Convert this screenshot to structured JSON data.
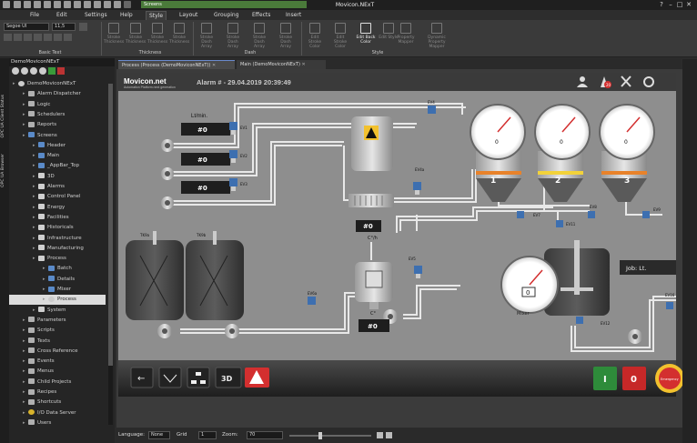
{
  "app": {
    "title": "Movicon.NExT",
    "screens_tab": "Screens"
  },
  "menu": [
    "File",
    "Edit",
    "Settings",
    "Help",
    "Style",
    "Layout",
    "Grouping",
    "Effects",
    "Insert"
  ],
  "ribbon": {
    "font_name": "Segoe UI",
    "font_size": "11,5",
    "groups": [
      "Basic Text",
      "Thickness",
      "Dash",
      "Style"
    ],
    "buttons": [
      {
        "label": "Stroke Thickness",
        "active": false
      },
      {
        "label": "Stroke Thickness",
        "active": false
      },
      {
        "label": "Stroke Thickness",
        "active": false
      },
      {
        "label": "Stroke Thickness",
        "active": false
      },
      {
        "label": "Stroke Dash Array",
        "active": false
      },
      {
        "label": "Stroke Dash Array",
        "active": false
      },
      {
        "label": "Stroke Dash Array",
        "active": false
      },
      {
        "label": "Stroke Dash Array",
        "active": false
      },
      {
        "label": "Edit Stroke Color",
        "active": false
      },
      {
        "label": "Edit Stroke Color",
        "active": false
      },
      {
        "label": "Edit Back Color",
        "active": true
      },
      {
        "label": "Edit Style",
        "active": false
      },
      {
        "label": "Property Mapper",
        "active": false
      },
      {
        "label": "Dynamic Property Mapper",
        "active": false
      }
    ]
  },
  "project_explorer": {
    "title": "DemoMoviconNExT",
    "side_tabs": [
      "OPC UA Client Status",
      "OPC UA Browser"
    ],
    "tree": [
      {
        "label": "DemoMoviconNExT",
        "level": 0,
        "icon": "gear",
        "selected": false
      },
      {
        "label": "Alarm Dispatcher",
        "level": 1,
        "icon": "item",
        "selected": false
      },
      {
        "label": "Logic",
        "level": 1,
        "icon": "item",
        "selected": false
      },
      {
        "label": "Schedulers",
        "level": 1,
        "icon": "item",
        "selected": false
      },
      {
        "label": "Reports",
        "level": 1,
        "icon": "item",
        "selected": false
      },
      {
        "label": "Screens",
        "level": 1,
        "icon": "screen",
        "selected": false
      },
      {
        "label": "Header",
        "level": 2,
        "icon": "screen",
        "selected": false
      },
      {
        "label": "Main",
        "level": 2,
        "icon": "screen",
        "selected": false
      },
      {
        "label": "_AppBar_Top",
        "level": 2,
        "icon": "screen",
        "selected": false
      },
      {
        "label": "3D",
        "level": 2,
        "icon": "folder",
        "selected": false
      },
      {
        "label": "Alarms",
        "level": 2,
        "icon": "folder",
        "selected": false
      },
      {
        "label": "Control Panel",
        "level": 2,
        "icon": "folder",
        "selected": false
      },
      {
        "label": "Energy",
        "level": 2,
        "icon": "folder",
        "selected": false
      },
      {
        "label": "Facilities",
        "level": 2,
        "icon": "folder",
        "selected": false
      },
      {
        "label": "Historicals",
        "level": 2,
        "icon": "folder",
        "selected": false
      },
      {
        "label": "Infrastructure",
        "level": 2,
        "icon": "folder",
        "selected": false
      },
      {
        "label": "Manufacturing",
        "level": 2,
        "icon": "folder",
        "selected": false
      },
      {
        "label": "Process",
        "level": 2,
        "icon": "folder",
        "selected": false
      },
      {
        "label": "Batch",
        "level": 3,
        "icon": "screen",
        "selected": false
      },
      {
        "label": "Details",
        "level": 3,
        "icon": "screen",
        "selected": false
      },
      {
        "label": "Mixer",
        "level": 3,
        "icon": "screen",
        "selected": false
      },
      {
        "label": "Process",
        "level": 3,
        "icon": "gear",
        "selected": true
      },
      {
        "label": "System",
        "level": 2,
        "icon": "folder",
        "selected": false
      },
      {
        "label": "Parameters",
        "level": 1,
        "icon": "item",
        "selected": false
      },
      {
        "label": "Scripts",
        "level": 1,
        "icon": "item",
        "selected": false
      },
      {
        "label": "Texts",
        "level": 1,
        "icon": "item",
        "selected": false
      },
      {
        "label": "Cross Reference",
        "level": 1,
        "icon": "item",
        "selected": false
      },
      {
        "label": "Events",
        "level": 1,
        "icon": "item",
        "selected": false
      },
      {
        "label": "Menus",
        "level": 1,
        "icon": "item",
        "selected": false
      },
      {
        "label": "Child Projects",
        "level": 1,
        "icon": "item",
        "selected": false
      },
      {
        "label": "Recipes",
        "level": 1,
        "icon": "item",
        "selected": false
      },
      {
        "label": "Shortcuts",
        "level": 1,
        "icon": "item",
        "selected": false
      },
      {
        "label": "I/O Data Server",
        "level": 1,
        "icon": "io",
        "selected": false
      },
      {
        "label": "Users",
        "level": 1,
        "icon": "item",
        "selected": false
      }
    ]
  },
  "doc_tabs": [
    {
      "label": "Process (Process (DemoMoviconNExT))",
      "active": true
    },
    {
      "label": "Main (DemoMoviconNExT)",
      "active": false
    }
  ],
  "screen": {
    "logo": "Movicon.net",
    "logo_sub": "Automation Platform.next generation",
    "alarm_text": "Alarm # - 29.04.2019 20:39:49",
    "alarm_badge": "20",
    "flow_unit": "Lt/min.",
    "flow_values": [
      "#0",
      "#0",
      "#0"
    ],
    "valve_labels": [
      "EV1",
      "EV2",
      "EV3",
      "EV4",
      "EV4a",
      "EV5",
      "EV6a",
      "EV6b",
      "EV7",
      "EV8",
      "EV9",
      "EV11",
      "EV12",
      "EV16",
      "EV17"
    ],
    "temp_unit_1": "C°/h",
    "temp_value_1": "#0",
    "temp_unit_2": "C°",
    "temp_value_2": "#0",
    "tank_labels": [
      "TK9a",
      "TK9b"
    ],
    "silo_numbers": [
      "1",
      "2",
      "3"
    ],
    "gauge_readings": [
      "0",
      "0",
      "0"
    ],
    "mixer_label": "Mixer",
    "mixer_reading": "0",
    "job_label": "Job: Lt.",
    "tank_small_label": "0",
    "footer_buttons": [
      "←",
      "3D"
    ],
    "start_label": "I",
    "stop_label": "0",
    "emergency_label": "Emergency",
    "colors": {
      "accent_green": "#2e8b3a",
      "alarm_red": "#d32f2f",
      "silo_yellow": "#f2d23a",
      "silo_orange": "#e8822a"
    }
  },
  "status": {
    "language_label": "Language:",
    "language_value": "None",
    "grid_label": "Grid",
    "grid_value": "1",
    "zoom_label": "Zoom:",
    "zoom_value": "70"
  }
}
